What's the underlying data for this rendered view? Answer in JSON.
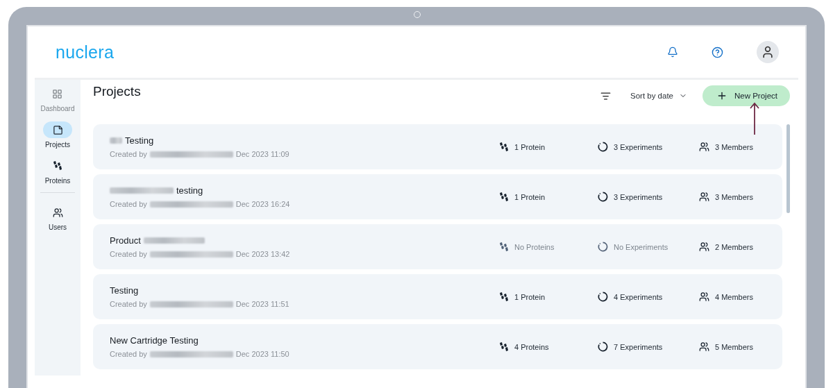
{
  "header": {
    "logo": "nuclera"
  },
  "sidebar": {
    "items": [
      {
        "label": "Dashboard",
        "selected": false,
        "disabled": true,
        "divider_before": false
      },
      {
        "label": "Projects",
        "selected": true,
        "disabled": false,
        "divider_before": false
      },
      {
        "label": "Proteins",
        "selected": false,
        "disabled": false,
        "divider_before": false
      },
      {
        "label": "Users",
        "selected": false,
        "disabled": false,
        "divider_before": true
      }
    ]
  },
  "page": {
    "title": "Projects",
    "sort": "Sort by date",
    "new_button": "New Project"
  },
  "projects": [
    {
      "title": "Testing",
      "redacted_before": true,
      "redacted_after": false,
      "created_by": "Created by",
      "date": "Dec 2023 11:09",
      "proteins": {
        "text": "1 Protein",
        "empty": false
      },
      "experiments": {
        "text": "3 Experiments",
        "empty": false
      },
      "members": "3 Members"
    },
    {
      "title": "testing",
      "redacted_before": true,
      "redacted_after": false,
      "created_by": "Created by",
      "date": "Dec 2023 16:24",
      "proteins": {
        "text": "1 Protein",
        "empty": false
      },
      "experiments": {
        "text": "3 Experiments",
        "empty": false
      },
      "members": "3 Members"
    },
    {
      "title": "Product",
      "redacted_before": false,
      "redacted_after": true,
      "created_by": "Created by",
      "date": "Dec 2023 13:42",
      "proteins": {
        "text": "No Proteins",
        "empty": true
      },
      "experiments": {
        "text": "No Experiments",
        "empty": true
      },
      "members": "2 Members"
    },
    {
      "title": "Testing",
      "redacted_before": false,
      "redacted_after": false,
      "created_by": "Created by",
      "date": "Dec 2023 11:51",
      "proteins": {
        "text": "1 Protein",
        "empty": false
      },
      "experiments": {
        "text": "4 Experiments",
        "empty": false
      },
      "members": "4 Members"
    },
    {
      "title": "New Cartridge Testing",
      "redacted_before": false,
      "redacted_after": false,
      "created_by": "Created by",
      "date": "Dec 2023 11:50",
      "proteins": {
        "text": "4 Proteins",
        "empty": false
      },
      "experiments": {
        "text": "7 Experiments",
        "empty": false
      },
      "members": "5 Members"
    }
  ]
}
